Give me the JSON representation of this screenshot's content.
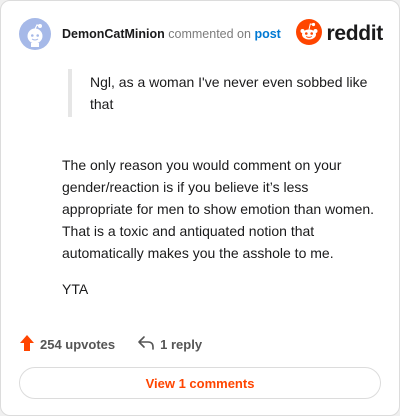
{
  "header": {
    "username": "DemonCatMinion",
    "commented_on": "commented on",
    "post_link": "post",
    "brand_word": "reddit"
  },
  "quote": {
    "text": "Ngl, as a woman I've never even sobbed like that"
  },
  "comment": {
    "paragraphs": [
      "The only reason you would comment on your gender/reaction is if you believe it’s less appropriate for men to show emotion than women. That is a toxic and antiquated notion that automatically makes you the asshole to me.",
      "YTA"
    ]
  },
  "actions": {
    "upvotes": "254 upvotes",
    "replies": "1 reply"
  },
  "view_button": {
    "label": "View 1 comments"
  },
  "colors": {
    "brand_orange": "#ff4500",
    "link_blue": "#0079d3",
    "avatar_bg": "#a6b9e8"
  },
  "icons": {
    "avatar": "snoo-avatar-icon",
    "brand": "reddit-logo-icon",
    "upvote": "upvote-arrow-icon",
    "reply": "reply-arrow-icon"
  }
}
